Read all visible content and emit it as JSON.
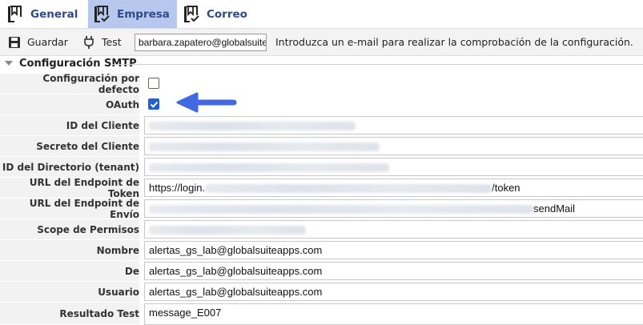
{
  "tabs": [
    {
      "label": "General",
      "icon": "bookmark-icon"
    },
    {
      "label": "Empresa",
      "icon": "bookmark-check-icon",
      "active": true
    },
    {
      "label": "Correo",
      "icon": "bookmark-check-icon"
    }
  ],
  "toolbar": {
    "save_label": "Guardar",
    "test_label": "Test",
    "test_email_value": "barbara.zapatero@globalsuiteapps.com",
    "message": "Introduzca un e-mail para realizar la comprobación de la configuración."
  },
  "section": {
    "title": "Configuración SMTP"
  },
  "form": {
    "default_config": {
      "label": "Configuración por defecto",
      "checked": false
    },
    "oauth": {
      "label": "OAuth",
      "checked": true
    },
    "client_id": {
      "label": "ID del Cliente"
    },
    "client_secret": {
      "label": "Secreto del Cliente"
    },
    "tenant_id": {
      "label": "ID del Directorio (tenant)"
    },
    "token_url": {
      "label": "URL del Endpoint de Token",
      "prefix": "https://login.",
      "suffix": "/token"
    },
    "send_url": {
      "label": "URL del Endpoint de Envío",
      "suffix": "sendMail"
    },
    "scope": {
      "label": "Scope de Permisos"
    },
    "name": {
      "label": "Nombre",
      "value": "alertas_gs_lab@globalsuiteapps.com"
    },
    "from": {
      "label": "De",
      "value": "alertas_gs_lab@globalsuiteapps.com"
    },
    "user": {
      "label": "Usuario",
      "value": "alertas_gs_lab@globalsuiteapps.com"
    },
    "test_result": {
      "label": "Resultado Test",
      "value": "message_E007"
    }
  },
  "colors": {
    "accent": "#2f4a8a",
    "active_tab": "#b7c7ee",
    "checkbox": "#2160d6",
    "arrow": "#4169e1"
  }
}
